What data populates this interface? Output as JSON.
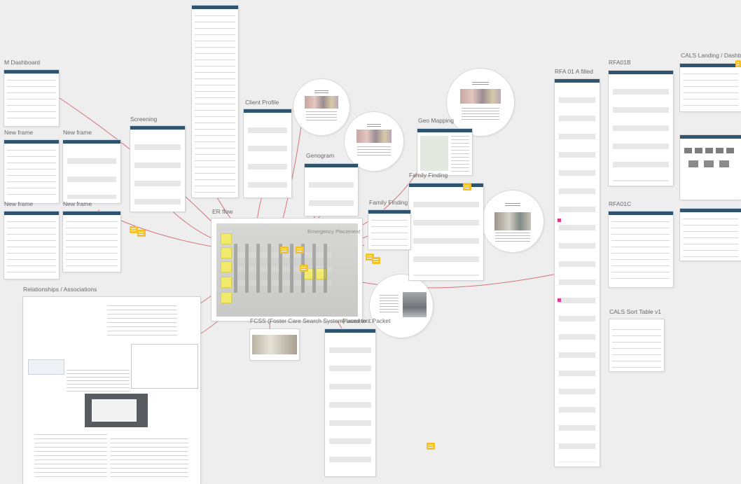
{
  "labels": {
    "m_dashboard": "M Dashboard",
    "new_frame_1": "New frame",
    "new_frame_2": "New frame",
    "new_frame_3": "New frame",
    "new_frame_4": "New frame",
    "screening": "Screening",
    "client_profile": "Client Profile",
    "geo_mapping": "Geo Mapping",
    "genogram": "Genogram",
    "family_finding_1": "Family Finding",
    "family_finding_2": "Family Finding",
    "er_flow": "ER flow",
    "emergency_placement": "Emergency Placement",
    "relationships": "Relationships / Associations",
    "fcss": "FCSS (Foster Care Search System) used to ...",
    "placement_packet": "Placement Packet",
    "rfa01_filled": "RFA 01 A filled",
    "rfa01b": "RFA01B",
    "rfa01c": "RFA01C",
    "cals_landing": "CALS Landing / Dashboa",
    "cals_sort": "CALS Sort Table v1"
  },
  "colors": {
    "canvas": "#eeeeee",
    "frame_header": "#2f5470",
    "link_line": "#d4737c",
    "sticky": "#f6c22b",
    "sticky_orange": "#f08a24",
    "marker": "#e13b8f"
  },
  "icons": {
    "sticky_note": "sticky-note-icon",
    "comment": "comment-icon"
  }
}
